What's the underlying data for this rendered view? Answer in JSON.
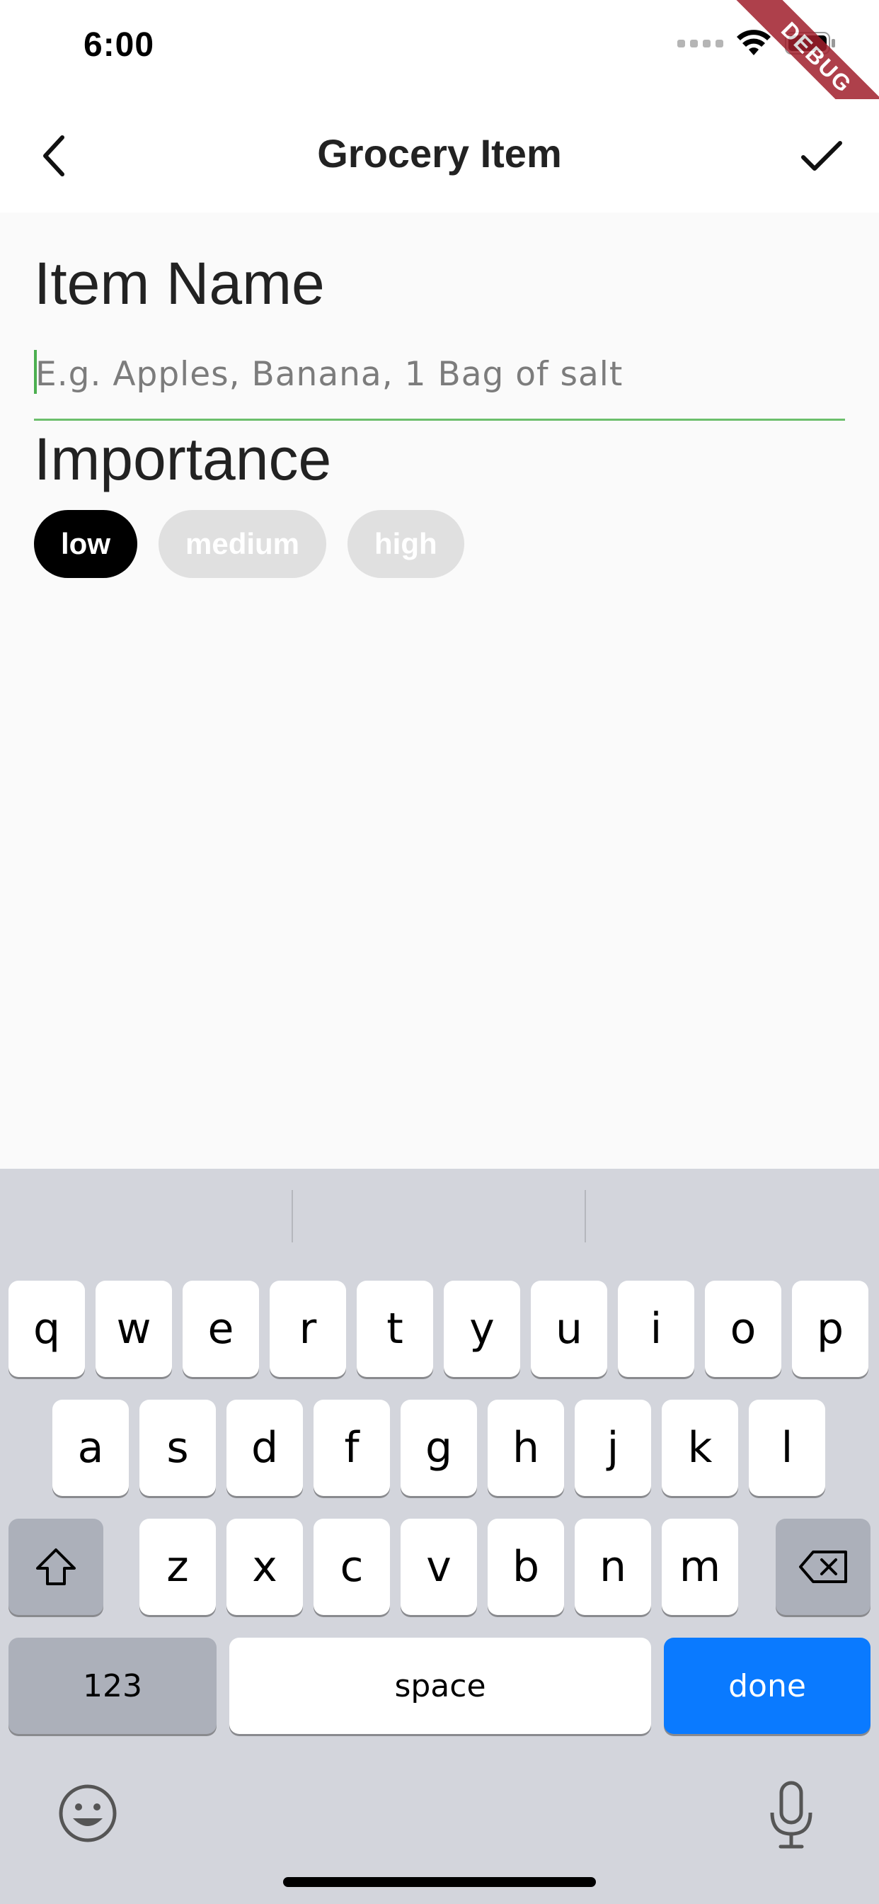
{
  "status_bar": {
    "time": "6:00",
    "debug_label": "DEBUG"
  },
  "app_bar": {
    "title": "Grocery Item"
  },
  "form": {
    "item_name_label": "Item Name",
    "item_name_placeholder": "E.g. Apples, Banana, 1 Bag of salt",
    "item_name_value": "",
    "importance_label": "Importance",
    "importance_options": [
      "low",
      "medium",
      "high"
    ],
    "importance_selected": "low"
  },
  "colors": {
    "accent_underline": "#6cbf6c",
    "chip_selected": "#000000",
    "chip_unselected": "#e0e0e0",
    "done_key": "#0a7aff"
  },
  "keyboard": {
    "row1": [
      "q",
      "w",
      "e",
      "r",
      "t",
      "y",
      "u",
      "i",
      "o",
      "p"
    ],
    "row2": [
      "a",
      "s",
      "d",
      "f",
      "g",
      "h",
      "j",
      "k",
      "l"
    ],
    "row3": [
      "z",
      "x",
      "c",
      "v",
      "b",
      "n",
      "m"
    ],
    "numbers_label": "123",
    "space_label": "space",
    "done_label": "done",
    "shift_icon": "shift-icon",
    "delete_icon": "backspace-icon",
    "emoji_icon": "emoji-icon",
    "mic_icon": "microphone-icon"
  }
}
